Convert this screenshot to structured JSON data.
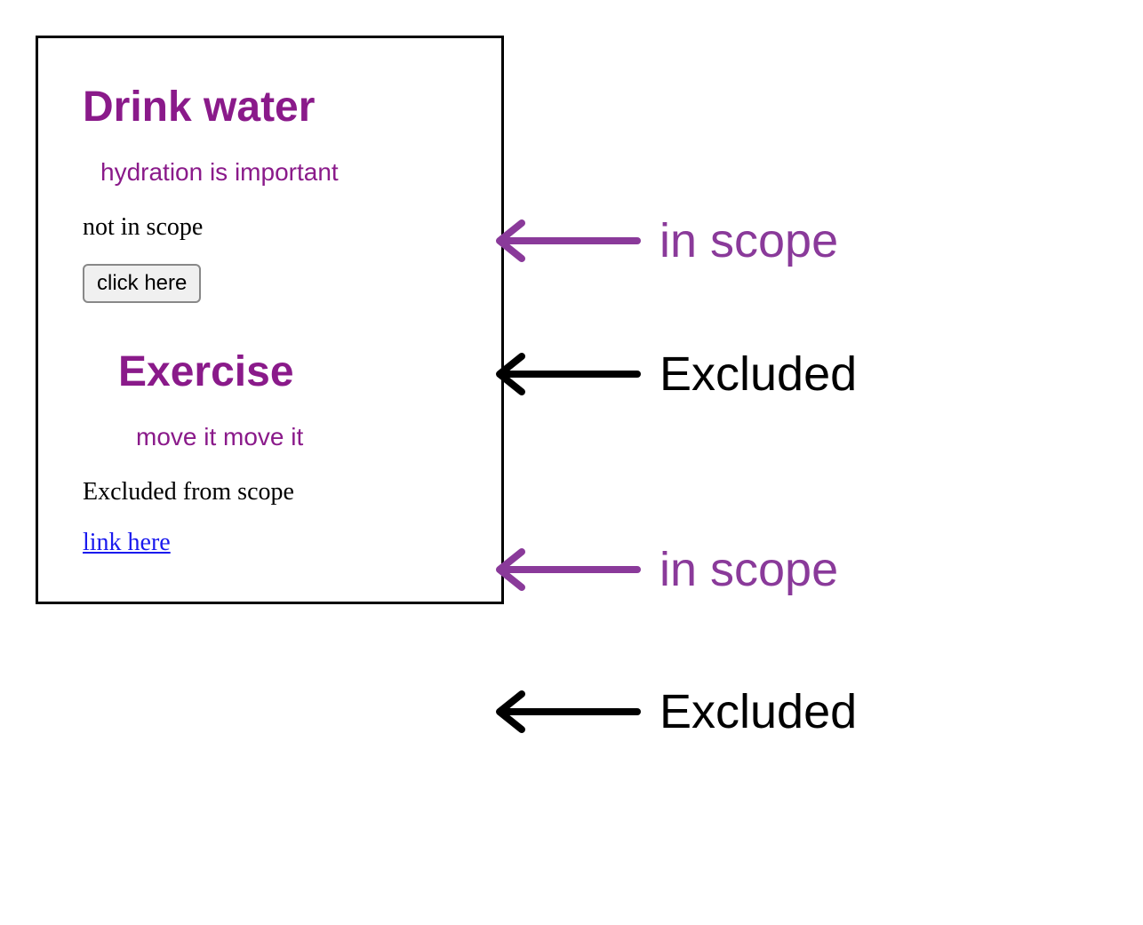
{
  "card": {
    "section1": {
      "heading": "Drink water",
      "subtext": "hydration is important",
      "plaintext": "not in scope",
      "button_label": "click here"
    },
    "section2": {
      "heading": "Exercise",
      "subtext": "move it move it",
      "plaintext": "Excluded from scope",
      "link_label": "link here"
    }
  },
  "annotations": {
    "a1": "in scope",
    "a2": "Excluded",
    "a3": "in scope",
    "a4": "Excluded"
  },
  "colors": {
    "scope_purple": "#8a1a8a",
    "annotation_purple": "#8a3a9a",
    "link_blue": "#1a1aee"
  }
}
